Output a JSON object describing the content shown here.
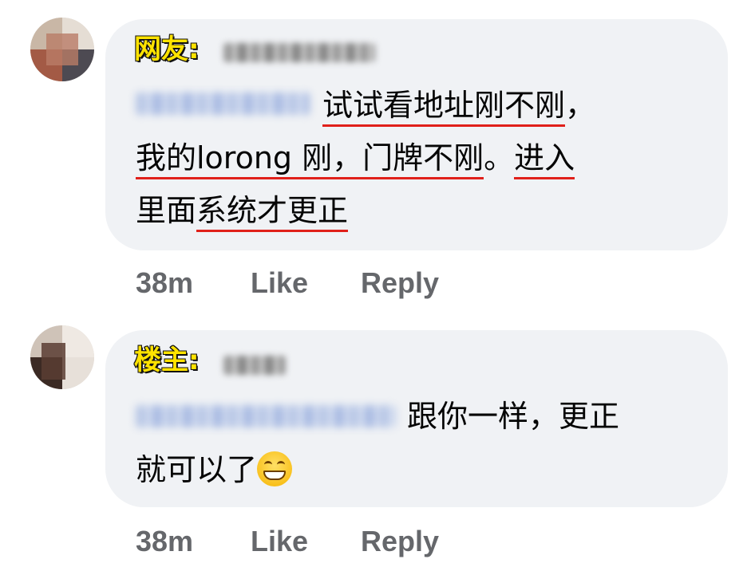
{
  "comments": [
    {
      "tag": "网友:",
      "text_part1": "试试看地址刚不刚",
      "text_part1_end": "，",
      "text_line2_a": "我的lorong 刚，门牌不刚",
      "text_line2_b": "。",
      "text_line2_c": "进入",
      "text_line3_a": "里面",
      "text_line3_b": "系统才更正",
      "time": "38m",
      "like": "Like",
      "reply": "Reply"
    },
    {
      "tag": "楼主:",
      "text_part1": "跟你一样，更正",
      "text_line2": "就可以了",
      "emoji": "grinning-face-emoji",
      "time": "38m",
      "like": "Like",
      "reply": "Reply"
    }
  ],
  "colors": {
    "bubble": "#f0f2f5",
    "tag_fill": "#ffe300",
    "underline": "#e0201a",
    "action_text": "#65676b"
  }
}
